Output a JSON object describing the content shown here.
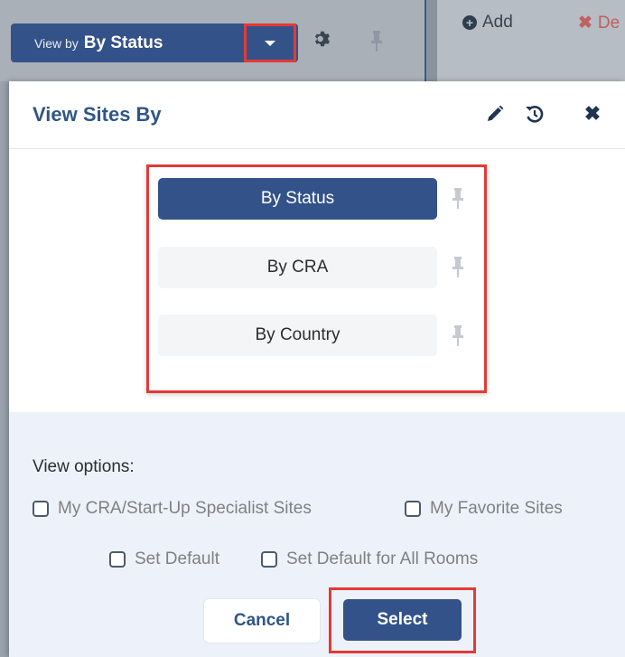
{
  "toolbar": {
    "view_by_prefix": "View by",
    "view_by_value": "By Status",
    "add_label": "Add",
    "delete_label": "De"
  },
  "modal": {
    "title": "View Sites By",
    "options": [
      {
        "label": "By Status",
        "selected": true
      },
      {
        "label": "By CRA",
        "selected": false
      },
      {
        "label": "By Country",
        "selected": false
      }
    ],
    "view_options_label": "View options:",
    "checkboxes": {
      "my_cra": {
        "label": "My CRA/Start-Up Specialist Sites",
        "checked": false
      },
      "my_favorites": {
        "label": "My Favorite Sites",
        "checked": false
      },
      "set_default": {
        "label": "Set Default",
        "checked": false
      },
      "set_default_all": {
        "label": "Set Default for All Rooms",
        "checked": false
      }
    },
    "cancel_label": "Cancel",
    "select_label": "Select"
  },
  "colors": {
    "primary": "#34528a",
    "title": "#2f5685",
    "highlight": "#e53935",
    "options_bg": "#edf2fa"
  },
  "icons": [
    "caret-down-icon",
    "gear-icon",
    "pin-icon",
    "add-circle-icon",
    "delete-x-icon",
    "pencil-icon",
    "undo-icon",
    "close-icon"
  ]
}
